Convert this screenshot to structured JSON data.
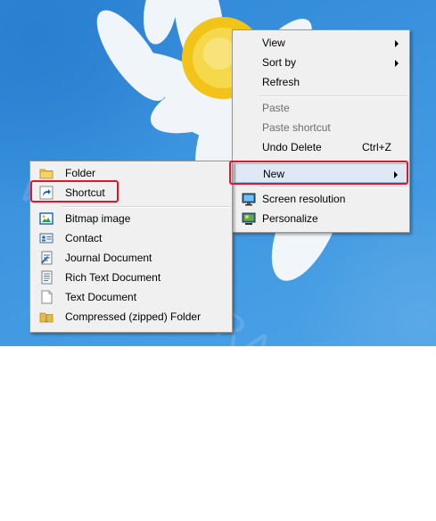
{
  "watermark": "WWW.ASARAN.IIM.COM",
  "context_menu": {
    "items": [
      {
        "label": "View",
        "submenu": true
      },
      {
        "label": "Sort by",
        "submenu": true
      },
      {
        "label": "Refresh"
      },
      {
        "label": "Paste",
        "disabled": true
      },
      {
        "label": "Paste shortcut",
        "disabled": true
      },
      {
        "label": "Undo Delete",
        "shortcut": "Ctrl+Z"
      },
      {
        "label": "New",
        "submenu": true,
        "highlighted": true
      },
      {
        "label": "Screen resolution",
        "icon": "screen-resolution-icon"
      },
      {
        "label": "Personalize",
        "icon": "personalize-icon"
      }
    ]
  },
  "new_submenu": {
    "items": [
      {
        "label": "Folder",
        "icon": "folder-icon"
      },
      {
        "label": "Shortcut",
        "icon": "shortcut-icon",
        "highlighted": true
      },
      {
        "label": "Bitmap image",
        "icon": "bitmap-image-icon"
      },
      {
        "label": "Contact",
        "icon": "contact-icon"
      },
      {
        "label": "Journal Document",
        "icon": "journal-document-icon"
      },
      {
        "label": "Rich Text Document",
        "icon": "rich-text-document-icon"
      },
      {
        "label": "Text Document",
        "icon": "text-document-icon"
      },
      {
        "label": "Compressed (zipped) Folder",
        "icon": "zip-folder-icon"
      }
    ]
  },
  "colors": {
    "highlight_outline": "#e0162b",
    "menu_background": "#f0f0f0",
    "desktop_blue": "#3d95df"
  }
}
